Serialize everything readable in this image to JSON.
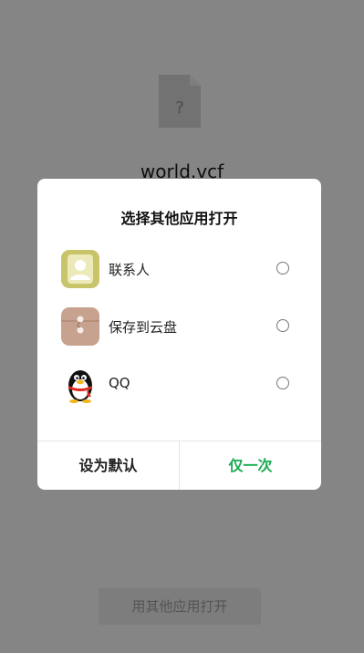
{
  "background": {
    "file_name": "world.vcf",
    "file_icon": "unknown-file-icon",
    "file_icon_glyph": "?",
    "open_other_label": "用其他应用打开"
  },
  "dialog": {
    "title": "选择其他应用打开",
    "apps": [
      {
        "label": "联系人",
        "icon": "contacts-icon"
      },
      {
        "label": "保存到云盘",
        "icon": "cloud-disk-icon"
      },
      {
        "label": "QQ",
        "icon": "qq-penguin-icon"
      }
    ],
    "buttons": {
      "set_default": "设为默认",
      "just_once": "仅一次"
    }
  },
  "colors": {
    "accent_green": "#1aad52",
    "contacts_icon": "#c9c46a",
    "cloud_disk_icon": "#c7a28e"
  }
}
